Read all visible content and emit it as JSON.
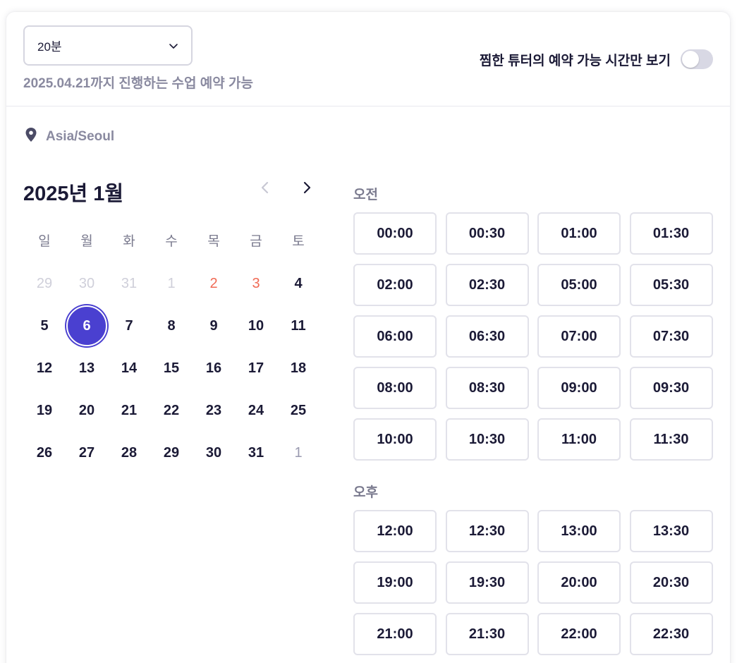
{
  "duration_select": {
    "value": "20분"
  },
  "booking_deadline": "2025.04.21까지 진행하는 수업 예약 가능",
  "favorites_toggle": {
    "label": "찜한 튜터의 예약 가능 시간만 보기",
    "on": false
  },
  "timezone": {
    "label": "Asia/Seoul",
    "icon": "location-pin-icon"
  },
  "calendar": {
    "title": "2025년 1월",
    "prev_icon": "chevron-left-icon",
    "next_icon": "chevron-right-icon",
    "weekdays": [
      "일",
      "월",
      "화",
      "수",
      "목",
      "금",
      "토"
    ],
    "days": [
      {
        "label": "29",
        "state": "muted"
      },
      {
        "label": "30",
        "state": "muted"
      },
      {
        "label": "31",
        "state": "muted"
      },
      {
        "label": "1",
        "state": "muted"
      },
      {
        "label": "2",
        "state": "holiday"
      },
      {
        "label": "3",
        "state": "holiday"
      },
      {
        "label": "4",
        "state": "normal"
      },
      {
        "label": "5",
        "state": "normal"
      },
      {
        "label": "6",
        "state": "selected"
      },
      {
        "label": "7",
        "state": "normal"
      },
      {
        "label": "8",
        "state": "normal"
      },
      {
        "label": "9",
        "state": "normal"
      },
      {
        "label": "10",
        "state": "normal"
      },
      {
        "label": "11",
        "state": "normal"
      },
      {
        "label": "12",
        "state": "normal"
      },
      {
        "label": "13",
        "state": "normal"
      },
      {
        "label": "14",
        "state": "normal"
      },
      {
        "label": "15",
        "state": "normal"
      },
      {
        "label": "16",
        "state": "normal"
      },
      {
        "label": "17",
        "state": "normal"
      },
      {
        "label": "18",
        "state": "normal"
      },
      {
        "label": "19",
        "state": "normal"
      },
      {
        "label": "20",
        "state": "normal"
      },
      {
        "label": "21",
        "state": "normal"
      },
      {
        "label": "22",
        "state": "normal"
      },
      {
        "label": "23",
        "state": "normal"
      },
      {
        "label": "24",
        "state": "normal"
      },
      {
        "label": "25",
        "state": "normal"
      },
      {
        "label": "26",
        "state": "normal"
      },
      {
        "label": "27",
        "state": "normal"
      },
      {
        "label": "28",
        "state": "normal"
      },
      {
        "label": "29",
        "state": "normal"
      },
      {
        "label": "30",
        "state": "normal"
      },
      {
        "label": "31",
        "state": "normal"
      },
      {
        "label": "1",
        "state": "muted-next"
      }
    ]
  },
  "time_slots": {
    "am": {
      "label": "오전",
      "slots": [
        "00:00",
        "00:30",
        "01:00",
        "01:30",
        "02:00",
        "02:30",
        "05:00",
        "05:30",
        "06:00",
        "06:30",
        "07:00",
        "07:30",
        "08:00",
        "08:30",
        "09:00",
        "09:30",
        "10:00",
        "10:30",
        "11:00",
        "11:30"
      ]
    },
    "pm": {
      "label": "오후",
      "slots": [
        "12:00",
        "12:30",
        "13:00",
        "13:30",
        "19:00",
        "19:30",
        "20:00",
        "20:30",
        "21:00",
        "21:30",
        "22:00",
        "22:30"
      ]
    }
  },
  "colors": {
    "accent": "#4a40d0",
    "holiday": "#f06a55",
    "muted": "#8a8aa0"
  }
}
